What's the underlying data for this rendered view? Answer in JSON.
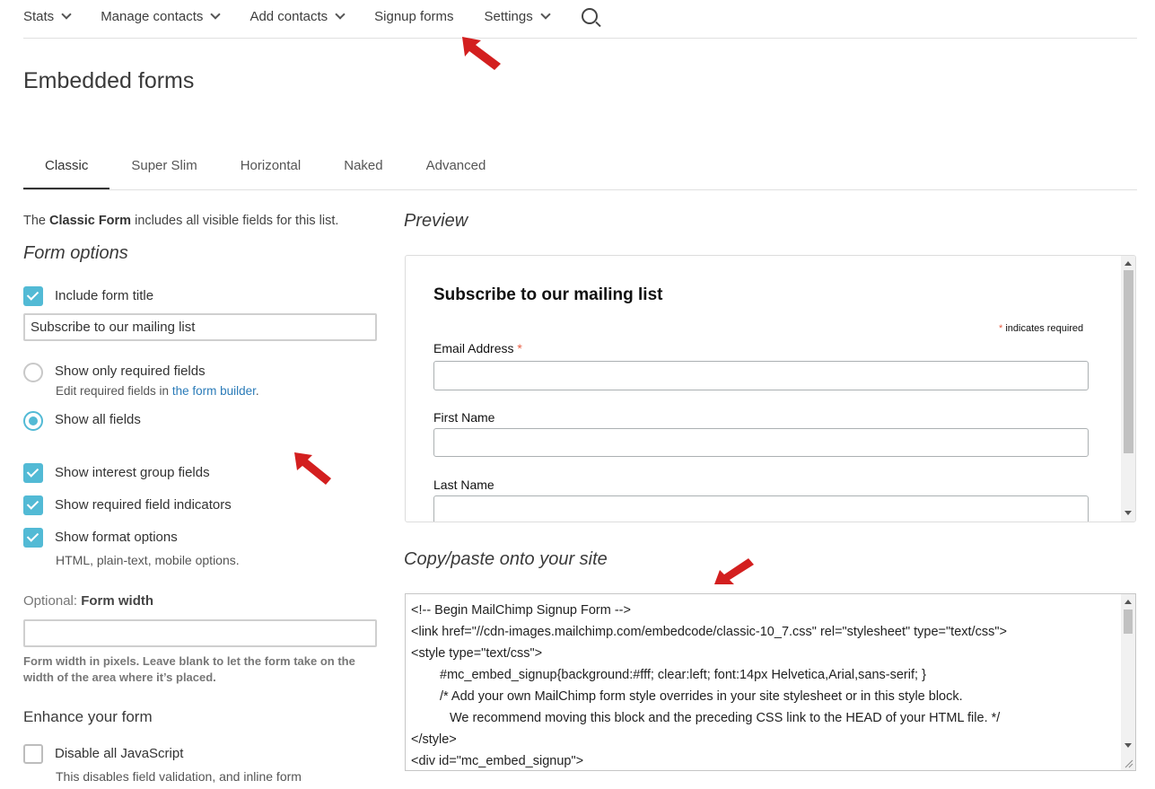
{
  "nav": {
    "items": [
      {
        "label": "Stats",
        "dropdown": true
      },
      {
        "label": "Manage contacts",
        "dropdown": true
      },
      {
        "label": "Add contacts",
        "dropdown": true
      },
      {
        "label": "Signup forms",
        "dropdown": false
      },
      {
        "label": "Settings",
        "dropdown": true
      }
    ],
    "search_icon": "search-icon"
  },
  "page": {
    "title": "Embedded forms"
  },
  "tabs": [
    {
      "label": "Classic",
      "active": true
    },
    {
      "label": "Super Slim",
      "active": false
    },
    {
      "label": "Horizontal",
      "active": false
    },
    {
      "label": "Naked",
      "active": false
    },
    {
      "label": "Advanced",
      "active": false
    }
  ],
  "left": {
    "intro_prefix": "The ",
    "intro_bold": "Classic Form",
    "intro_suffix": " includes all visible fields for this list.",
    "form_options_heading": "Form options",
    "include_title": {
      "label": "Include form title",
      "checked": true
    },
    "title_input_value": "Subscribe to our mailing list",
    "radio_required": {
      "label": "Show only required fields",
      "selected": false
    },
    "radio_required_sub_prefix": "Edit required fields in ",
    "radio_required_sub_link": "the form builder",
    "radio_required_sub_suffix": ".",
    "radio_all": {
      "label": "Show all fields",
      "selected": true
    },
    "interest_groups": {
      "label": "Show interest group fields",
      "checked": true
    },
    "required_indicators": {
      "label": "Show required field indicators",
      "checked": true
    },
    "format_options": {
      "label": "Show format options",
      "checked": true
    },
    "format_options_sub": "HTML, plain-text, mobile options.",
    "width_label_prefix": "Optional: ",
    "width_label_bold": "Form width",
    "width_value": "",
    "width_help": "Form width in pixels. Leave blank to let the form take on the width of the area where it’s placed.",
    "enhance_heading": "Enhance your form",
    "disable_js": {
      "label": "Disable all JavaScript",
      "checked": false
    },
    "disable_js_sub": "This disables field validation, and inline form"
  },
  "preview": {
    "heading": "Preview",
    "form_title": "Subscribe to our mailing list",
    "required_note_star": "*",
    "required_note": " indicates required",
    "fields": [
      {
        "label": "Email Address",
        "required": true,
        "star": "*"
      },
      {
        "label": "First Name",
        "required": false
      },
      {
        "label": "Last Name",
        "required": false
      }
    ]
  },
  "code": {
    "heading": "Copy/paste onto your site",
    "lines": [
      "<!-- Begin MailChimp Signup Form -->",
      "<link href=\"//cdn-images.mailchimp.com/embedcode/classic-10_7.css\" rel=\"stylesheet\" type=\"text/css\">",
      "<style type=\"text/css\">",
      "#mc_embed_signup{background:#fff; clear:left; font:14px Helvetica,Arial,sans-serif; }",
      "/* Add your own MailChimp form style overrides in your site stylesheet or in this style block.",
      "We recommend moving this block and the preceding CSS link to the HEAD of your HTML file. */",
      "</style>",
      "<div id=\"mc_embed_signup\">"
    ]
  },
  "colors": {
    "accent": "#52bad5",
    "annotation_arrow": "#d31f1f",
    "link": "#2a7bb8",
    "required_star": "#e85c41"
  }
}
